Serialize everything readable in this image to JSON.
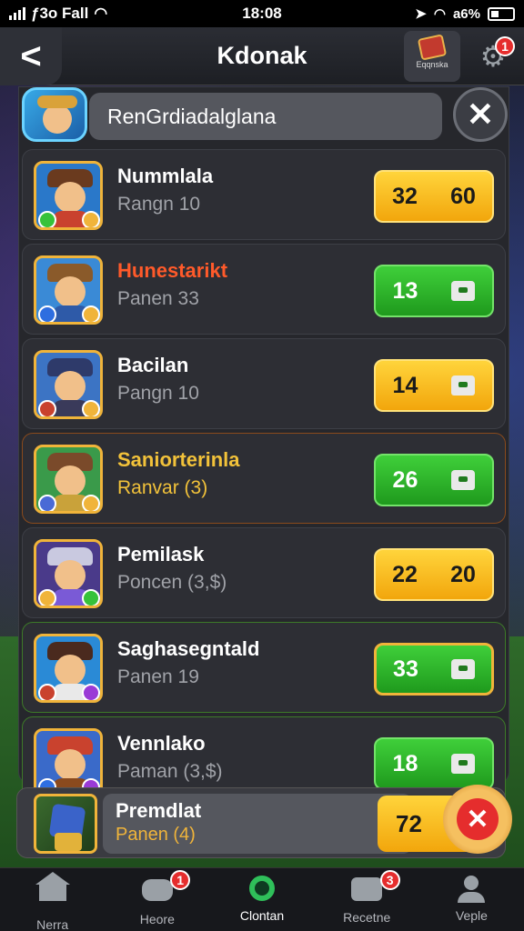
{
  "status_bar": {
    "carrier": "ƒ3o Fall",
    "time": "18:08",
    "battery": "a6%"
  },
  "header": {
    "back": "<",
    "title": "Kdonak",
    "gift_label": "Eqqnska",
    "settings_badge": "1"
  },
  "search": {
    "value": "RenGrdiadalglana"
  },
  "list": [
    {
      "name": "Nummlala",
      "sub": "Rangn 10",
      "v1": "32",
      "v2": "60",
      "style": "yellow",
      "name_color": "#ffffff",
      "sub_color": "#a0a2a8"
    },
    {
      "name": "Hunestarikt",
      "sub": "Panen 33",
      "v1": "13",
      "v2": "",
      "style": "green",
      "name_color": "#ff5a2a",
      "sub_color": "#a0a2a8"
    },
    {
      "name": "Bacilan",
      "sub": "Pangn 10",
      "v1": "14",
      "v2": "",
      "style": "yellow-icon",
      "name_color": "#ffffff",
      "sub_color": "#a0a2a8"
    },
    {
      "name": "Saniorterinla",
      "sub": "Ranvar (3)",
      "v1": "26",
      "v2": "",
      "style": "green",
      "name_color": "#f2c23a",
      "sub_color": "#f2c23a"
    },
    {
      "name": "Pemilask",
      "sub": "Poncen (3,$)",
      "v1": "22",
      "v2": "20",
      "style": "yellow",
      "name_color": "#ffffff",
      "sub_color": "#a0a2a8"
    },
    {
      "name": "Saghasegntald",
      "sub": "Panen 19",
      "v1": "33",
      "v2": "",
      "style": "green-gold",
      "name_color": "#ffffff",
      "sub_color": "#a0a2a8"
    },
    {
      "name": "Vennlako",
      "sub": "Paman (3,$)",
      "v1": "18",
      "v2": "",
      "style": "green",
      "name_color": "#ffffff",
      "sub_color": "#a0a2a8"
    }
  ],
  "selected": {
    "name": "Premdlat",
    "sub": "Panen (4)",
    "value": "72"
  },
  "nav": [
    {
      "label": "Nerra",
      "icon": "home-icon",
      "badge": ""
    },
    {
      "label": "Heore",
      "icon": "chat-icon",
      "badge": "1"
    },
    {
      "label": "Clontan",
      "icon": "search-icon",
      "badge": ""
    },
    {
      "label": "Recetne",
      "icon": "inbox-icon",
      "badge": "3"
    },
    {
      "label": "Veple",
      "icon": "profile-icon",
      "badge": ""
    }
  ],
  "colors": {
    "accent_yellow": "#f2a60c",
    "accent_green": "#1f9a1d",
    "badge_red": "#e52d2d"
  }
}
